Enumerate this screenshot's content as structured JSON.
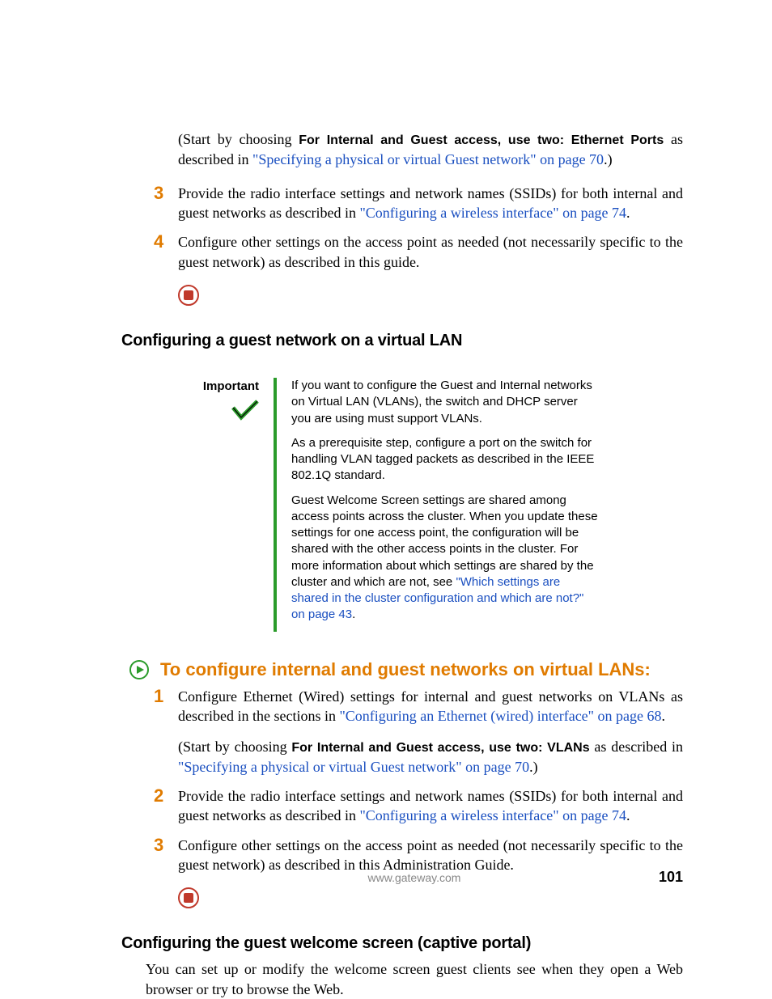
{
  "intro": {
    "prefix": "(Start by choosing ",
    "bold": "For Internal and Guest access, use two: Ethernet Ports",
    "mid": " as described in ",
    "link": "\"Specifying a physical or virtual Guest network\" on page 70",
    "suffix": ".)"
  },
  "list1": {
    "item3": {
      "num": "3",
      "pre": "Provide the radio interface settings and network names (SSIDs) for both internal and guest networks as described in ",
      "link": "\"Configuring a wireless interface\" on page 74",
      "post": "."
    },
    "item4": {
      "num": "4",
      "text": "Configure other settings on the access point as needed (not necessarily specific to the guest network) as described in this guide."
    }
  },
  "heading1": "Configuring a guest network on a virtual LAN",
  "callout": {
    "label": "Important",
    "p1": "If you want to configure the Guest and Internal networks on Virtual LAN (VLANs), the switch and DHCP server you are using must support VLANs.",
    "p2": "As a prerequisite step, configure a port on the switch for handling VLAN tagged packets as described in the IEEE 802.1Q standard.",
    "p3_pre": "Guest Welcome Screen settings are shared among access points across the cluster. When you update these settings for one access point, the configuration will be shared with the other access points in the cluster. For more information about which settings are shared by the cluster and which are not, see ",
    "p3_link": "\"Which settings are shared in the cluster configuration and which are not?\" on page 43",
    "p3_post": "."
  },
  "proc_heading": "To configure internal and guest networks on virtual LANs:",
  "list2": {
    "item1": {
      "num": "1",
      "pre": "Configure Ethernet (Wired) settings for internal and guest networks on VLANs as described in the sections in ",
      "link": "\"Configuring an Ethernet (wired) interface\" on page 68",
      "post": "."
    },
    "item1_sub": {
      "prefix": "(Start by choosing ",
      "bold": "For Internal and Guest access, use two: VLANs",
      "mid": " as described in ",
      "link": "\"Specifying a physical or virtual Guest network\" on page 70",
      "suffix": ".)"
    },
    "item2": {
      "num": "2",
      "pre": "Provide the radio interface settings and network names (SSIDs) for both internal and guest networks as described in ",
      "link": "\"Configuring a wireless interface\" on page 74",
      "post": "."
    },
    "item3": {
      "num": "3",
      "text": "Configure other settings on the access point as needed (not necessarily specific to the guest network) as described in this Administration Guide."
    }
  },
  "heading2": "Configuring the guest welcome screen (captive portal)",
  "para2": "You can set up or modify the welcome screen guest clients see when they open a Web browser or try to browse the Web.",
  "footer": {
    "url": "www.gateway.com",
    "page": "101"
  }
}
